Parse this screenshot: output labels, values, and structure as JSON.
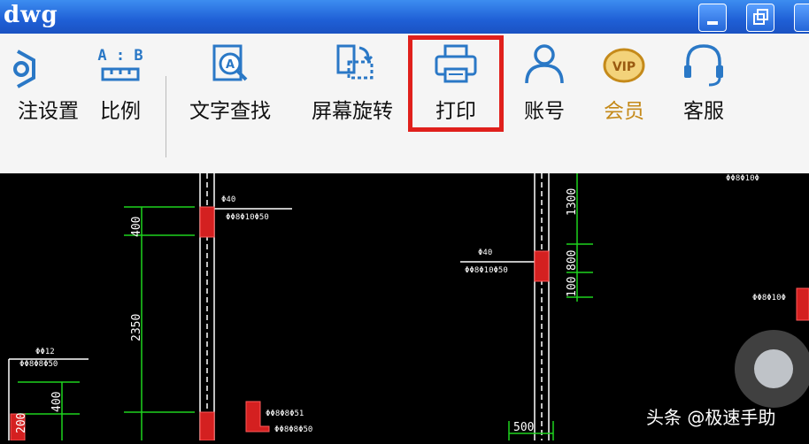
{
  "window": {
    "title": "dwg"
  },
  "toolbar": {
    "items": [
      {
        "label": "注设置",
        "icon": "gear-icon"
      },
      {
        "label": "比例",
        "icon": "ruler-icon"
      },
      {
        "label": "文字查找",
        "icon": "text-search-icon"
      },
      {
        "label": "屏幕旋转",
        "icon": "rotate-screen-icon"
      },
      {
        "label": "打印",
        "icon": "printer-icon"
      },
      {
        "label": "账号",
        "icon": "user-icon"
      },
      {
        "label": "会员",
        "icon": "vip-icon"
      },
      {
        "label": "客服",
        "icon": "headset-icon"
      }
    ],
    "ratio_icon_text": "A : B",
    "vip_text": "VIP",
    "highlight_color": "#e0201c"
  },
  "drawing": {
    "dims": [
      "400",
      "2350",
      "1300",
      "800",
      "100",
      "400",
      "200",
      "500"
    ]
  },
  "watermark": "头条 @极速手助"
}
